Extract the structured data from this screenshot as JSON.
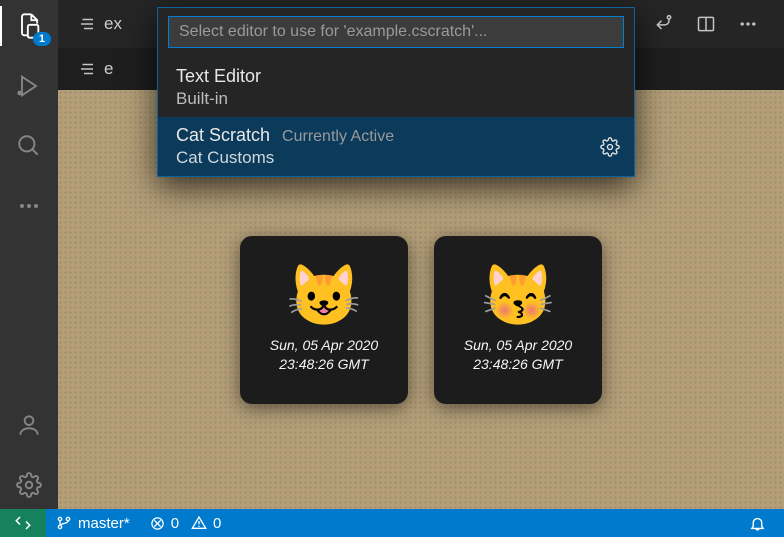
{
  "activitybar": {
    "explorer_badge": "1"
  },
  "tabs": {
    "top": {
      "label": "ex"
    },
    "inner": {
      "label": "e"
    }
  },
  "editor_actions": {},
  "quickpick": {
    "placeholder": "Select editor to use for 'example.cscratch'...",
    "items": [
      {
        "label": "Text Editor",
        "desc": "",
        "sub": "Built-in",
        "selected": false
      },
      {
        "label": "Cat Scratch",
        "desc": "Currently Active",
        "sub": "Cat Customs",
        "selected": true
      }
    ]
  },
  "cards": [
    {
      "emoji": "😺",
      "line1": "Sun, 05 Apr 2020",
      "line2": "23:48:26 GMT"
    },
    {
      "emoji": "😽",
      "line1": "Sun, 05 Apr 2020",
      "line2": "23:48:26 GMT"
    }
  ],
  "statusbar": {
    "branch": "master*",
    "errors": "0",
    "warnings": "0"
  }
}
